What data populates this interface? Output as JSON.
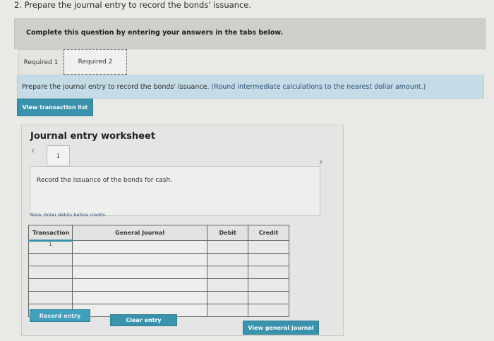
{
  "question": {
    "title": "2. Prepare the journal entry to record the bonds' issuance."
  },
  "banner": {
    "text": "Complete this question by entering your answers in the tabs below."
  },
  "tabs": [
    {
      "label": "Required 1"
    },
    {
      "label": "Required 2"
    }
  ],
  "instruction": {
    "text": "Prepare the journal entry to record the bonds' issuance.",
    "note": "(Round intermediate calculations to the nearest dollar amount.)"
  },
  "buttons": {
    "view_transaction": "View transaction list",
    "record_entry": "Record entry",
    "clear_entry": "Clear entry",
    "view_general_journal": "View general journal"
  },
  "worksheet": {
    "title": "Journal entry worksheet",
    "page": "1",
    "description": "Record the issuance of the bonds for cash.",
    "hint": "Note: Enter debits before credits."
  },
  "journal": {
    "headers": [
      "Transaction",
      "General Journal",
      "Debit",
      "Credit"
    ],
    "rows": [
      {
        "transaction": "1",
        "account": "",
        "debit": "",
        "credit": ""
      },
      {
        "transaction": "",
        "account": "",
        "debit": "",
        "credit": ""
      },
      {
        "transaction": "",
        "account": "",
        "debit": "",
        "credit": ""
      },
      {
        "transaction": "",
        "account": "",
        "debit": "",
        "credit": ""
      },
      {
        "transaction": "",
        "account": "",
        "debit": "",
        "credit": ""
      },
      {
        "transaction": "",
        "account": "",
        "debit": "",
        "credit": ""
      }
    ]
  },
  "colors": {
    "accent": "#3a93ad",
    "instruction_bg": "#c5dce6",
    "hint_text": "#2e4e7a"
  },
  "icons": {
    "prev": "chevron-left-icon",
    "next": "chevron-right-icon"
  }
}
